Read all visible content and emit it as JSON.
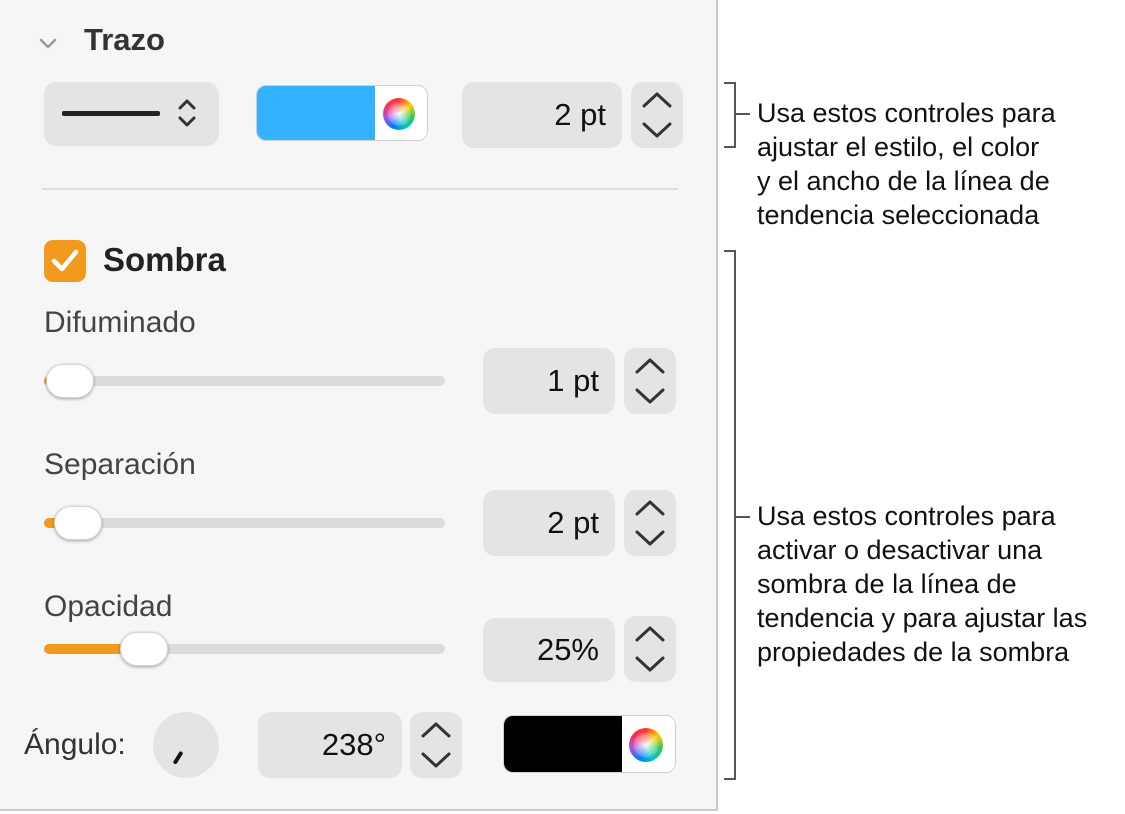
{
  "section": {
    "title": "Trazo"
  },
  "stroke": {
    "color": "#33b2ff",
    "width_value": "2 pt"
  },
  "shadow": {
    "checkbox_label": "Sombra",
    "checked": true,
    "accent_color": "#f29a1e",
    "blur": {
      "label": "Difuminado",
      "value": "1 pt",
      "slider_fraction": 0.02
    },
    "offset": {
      "label": "Separación",
      "value": "2 pt",
      "slider_fraction": 0.04
    },
    "opacity": {
      "label": "Opacidad",
      "value": "25%",
      "slider_fraction": 0.25
    },
    "angle": {
      "label": "Ángulo:",
      "value": "238°",
      "degrees": 238
    },
    "color": "#000000"
  },
  "callouts": {
    "top": [
      "Usa estos controles para",
      "ajustar el estilo, el color",
      "y el ancho de la línea de",
      "tendencia seleccionada"
    ],
    "bottom": [
      "Usa estos controles para",
      "activar o desactivar una",
      "sombra de la línea de",
      "tendencia y para ajustar las",
      "propiedades de la sombra"
    ]
  },
  "icons": [
    "chevron-down-icon",
    "updown-arrows-icon",
    "color-wheel-icon",
    "checkmark-icon",
    "stepper-up-icon",
    "stepper-down-icon",
    "angle-dial-icon"
  ]
}
